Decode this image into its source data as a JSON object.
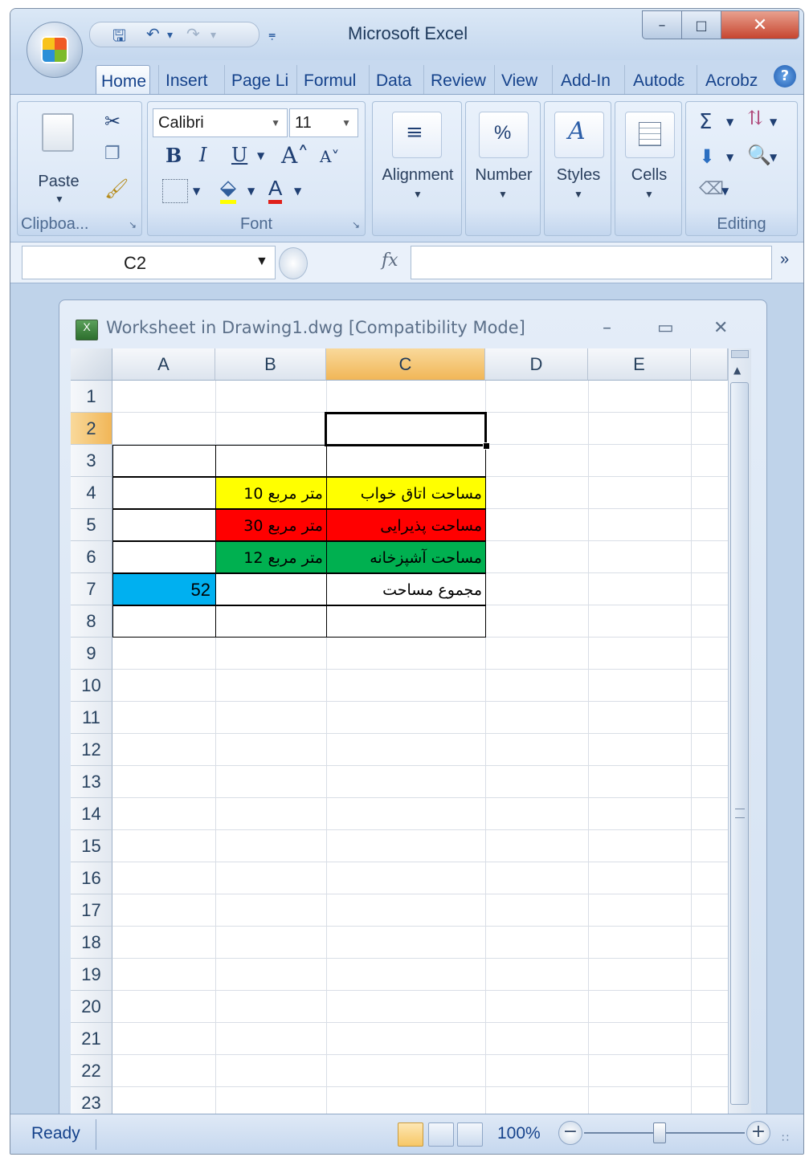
{
  "app": {
    "title": "Microsoft Excel"
  },
  "tabs": [
    "Home",
    "Insert",
    "Page Li",
    "Formul",
    "Data",
    "Review",
    "View",
    "Add-In",
    "Autodε",
    "Acrobz"
  ],
  "ribbon": {
    "clipboard": {
      "paste_label": "Paste",
      "group_label": "Clipboa..."
    },
    "font": {
      "name": "Calibri",
      "size": "11",
      "group_label": "Font"
    },
    "alignment_label": "Alignment",
    "number": {
      "symbol": "%",
      "label": "Number"
    },
    "styles_label": "Styles",
    "cells_label": "Cells",
    "editing_label": "Editing"
  },
  "formula_bar": {
    "name_box": "C2",
    "fx": "fx",
    "value": ""
  },
  "workbook": {
    "title": "Worksheet in Drawing1.dwg  [Compatibility Mode]"
  },
  "sheet": {
    "columns": [
      "A",
      "B",
      "C",
      "D",
      "E"
    ],
    "rows": [
      "1",
      "2",
      "3",
      "4",
      "5",
      "6",
      "7",
      "8",
      "9",
      "10",
      "11",
      "12",
      "13",
      "14",
      "15",
      "16",
      "17",
      "18",
      "19",
      "20",
      "21",
      "22",
      "23"
    ],
    "selected_cell": "C2",
    "cells": {
      "B4": "متر مربع 10",
      "C4": "مساحت اتاق خواب",
      "B5": "متر مربع 30",
      "C5": "مساحت پذیرایی",
      "B6": "متر مربع 12",
      "C6": "مساحت آشپزخانه",
      "A7": "52",
      "C7": "مجموع مساحت"
    },
    "fills": {
      "yellow": "#ffff00",
      "red": "#ff0000",
      "green": "#00b050",
      "blue": "#00b0f0"
    }
  },
  "status": {
    "ready": "Ready",
    "zoom": "100%"
  }
}
